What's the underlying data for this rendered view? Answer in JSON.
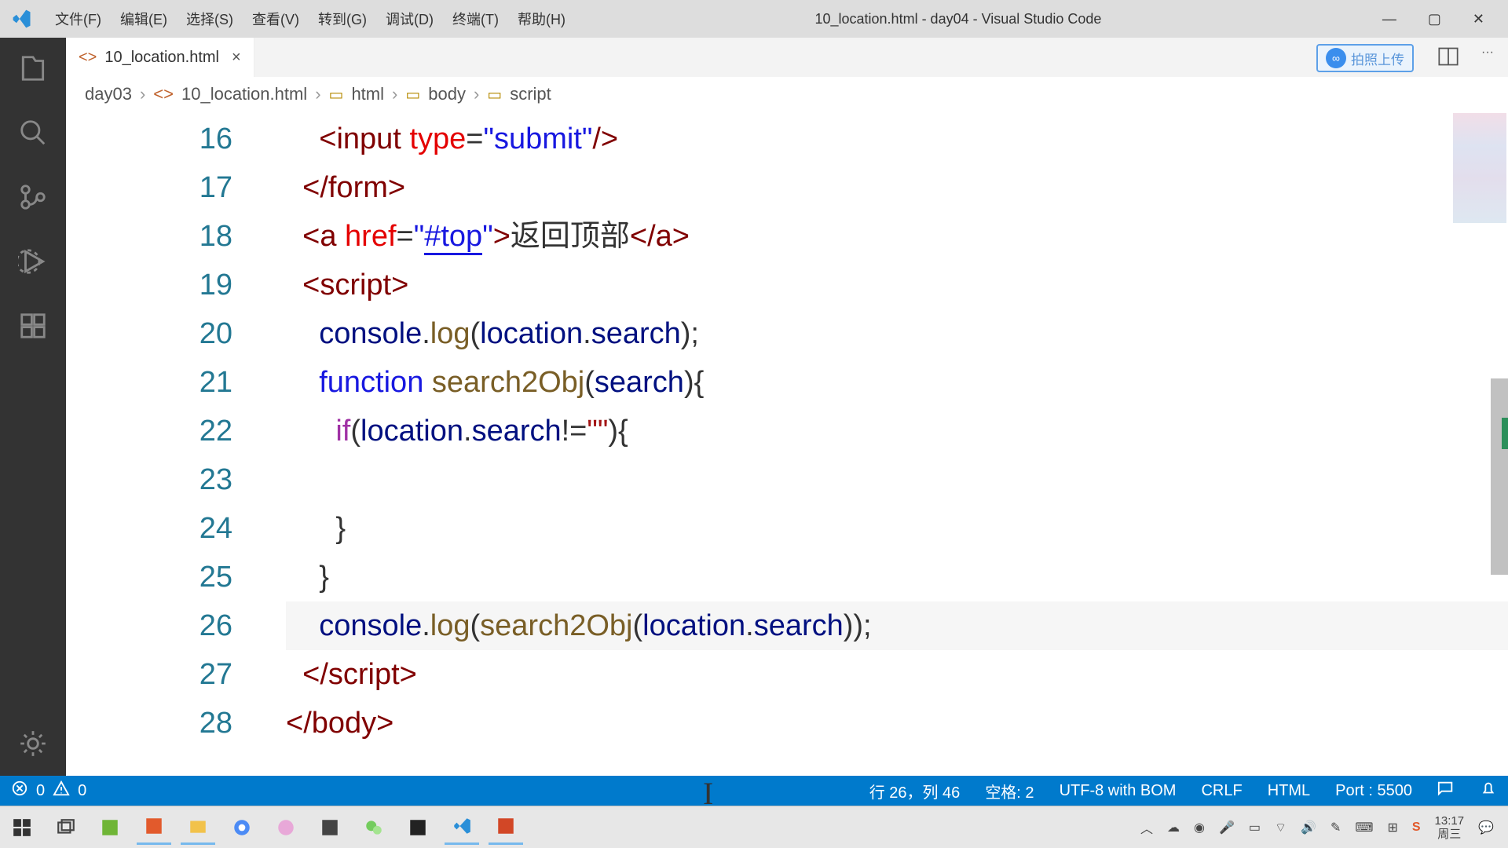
{
  "titlebar": {
    "menus": [
      "文件(F)",
      "编辑(E)",
      "选择(S)",
      "查看(V)",
      "转到(G)",
      "调试(D)",
      "终端(T)",
      "帮助(H)"
    ],
    "title": "10_location.html - day04 - Visual Studio Code"
  },
  "tab": {
    "filename": "10_location.html",
    "ext_badge": "拍照上传"
  },
  "breadcrumb": {
    "p0": "day03",
    "p1": "10_location.html",
    "p2": "html",
    "p3": "body",
    "p4": "script"
  },
  "gutter": [
    "16",
    "17",
    "18",
    "19",
    "20",
    "21",
    "22",
    "23",
    "24",
    "25",
    "26",
    "27",
    "28"
  ],
  "code": {
    "l16": {
      "ind": "    ",
      "a": "<",
      "b": "input",
      "sp": " ",
      "attr": "type",
      "eq": "=",
      "q1": "\"",
      "val": "submit",
      "q2": "\"",
      "end": "/>"
    },
    "l17": {
      "ind": "  ",
      "a": "</",
      "b": "form",
      "c": ">"
    },
    "l18": {
      "ind": "  ",
      "a": "<",
      "tag": "a",
      "sp": " ",
      "attr": "href",
      "eq": "=",
      "q1": "\"",
      "val": "#top",
      "q2": "\"",
      "gt": ">",
      "txt": "返回顶部",
      "ca": "</",
      "ctag": "a",
      "cgt": ">"
    },
    "l19": {
      "ind": "  ",
      "a": "<",
      "b": "script",
      "c": ">"
    },
    "l20": {
      "ind": "    ",
      "a": "console",
      "dot": ".",
      "fn": "log",
      "op": "(",
      "b": "location",
      "dot2": ".",
      "c": "search",
      "cl": ");"
    },
    "l21": {
      "ind": "    ",
      "kw": "function",
      "sp": " ",
      "fn": "search2Obj",
      "op": "(",
      "prm": "search",
      "cl": "){"
    },
    "l22": {
      "ind": "      ",
      "kw": "if",
      "op": "(",
      "a": "location",
      "dot": ".",
      "b": "search",
      "ne": "!=",
      "q": "\"\"",
      "cl": "){"
    },
    "l23": {
      "ind": ""
    },
    "l24": {
      "ind": "      ",
      "brace": "}"
    },
    "l25": {
      "ind": "    ",
      "brace": "}"
    },
    "l26": {
      "ind": "    ",
      "a": "console",
      "dot": ".",
      "fn": "log",
      "op": "(",
      "b": "search2Obj",
      "op2": "(",
      "c": "location",
      "dot2": ".",
      "d": "search",
      "cl": "));"
    },
    "l27": {
      "ind": "  ",
      "a": "</",
      "b": "script",
      "c": ">"
    },
    "l28": {
      "a": "</",
      "b": "body",
      "c": ">"
    }
  },
  "status": {
    "err": "0",
    "warn": "0",
    "pos": "行 26，列 46",
    "spaces": "空格: 2",
    "enc": "UTF-8 with BOM",
    "eol": "CRLF",
    "lang": "HTML",
    "port": "Port : 5500"
  },
  "taskbar": {
    "time": "13:17",
    "date": "周三"
  }
}
